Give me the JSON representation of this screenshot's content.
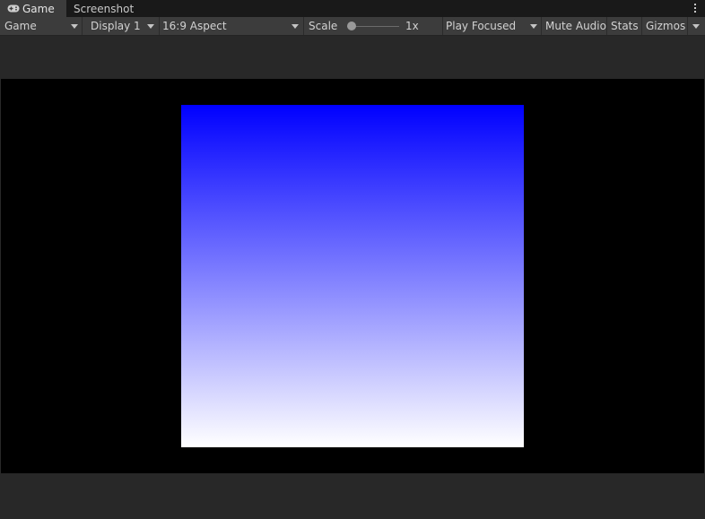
{
  "tabs": [
    {
      "label": "Game",
      "icon": "gamepad-icon",
      "active": true
    },
    {
      "label": "Screenshot",
      "active": false
    }
  ],
  "window_menu_icon": "kebab-menu-icon",
  "toolbar": {
    "view_mode": "Game",
    "display": "Display 1",
    "aspect": "16:9 Aspect",
    "scale_label": "Scale",
    "scale_value": "1x",
    "scale_level": 0,
    "play_mode": "Play Focused",
    "mute_audio": "Mute Audio",
    "stats": "Stats",
    "gizmos": "Gizmos"
  },
  "game_view": {
    "background_color": "#000000",
    "gradient_top": "#0000ff",
    "gradient_bottom": "#ffffff"
  },
  "colors": {
    "editor_bg": "#282828",
    "toolbar_bg": "#3c3c3c",
    "tabbar_bg": "#191919",
    "text": "#d2d2d2"
  }
}
